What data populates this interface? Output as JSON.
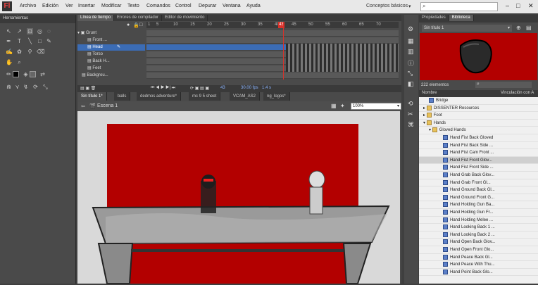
{
  "menubar": {
    "logo": "Fl",
    "items": [
      "Archivo",
      "Edición",
      "Ver",
      "Insertar",
      "Modificar",
      "Texto",
      "Comandos",
      "Control",
      "Depurar",
      "Ventana",
      "Ayuda"
    ],
    "workspace": "Conceptos básicos"
  },
  "tools": {
    "title": "Herramientas"
  },
  "timeline": {
    "tabs": [
      "Línea de tiempo",
      "Errores de compilador",
      "Editor de movimiento"
    ],
    "ruler": [
      "1",
      "5",
      "10",
      "15",
      "20",
      "25",
      "30",
      "35",
      "40",
      "45",
      "50",
      "55",
      "60",
      "65",
      "70"
    ],
    "layers": [
      {
        "name": "Grunt"
      },
      {
        "name": "Front ..."
      },
      {
        "name": "Head"
      },
      {
        "name": "Torso"
      },
      {
        "name": "Back H..."
      },
      {
        "name": "Feet"
      },
      {
        "name": "Backgrou..."
      }
    ],
    "status": {
      "frame": "43",
      "fps": "30.00 fps",
      "time": "1.4 s"
    }
  },
  "document_tabs": [
    "Sin título 1*",
    "balls",
    "dedmos adventure*",
    "mc 9 5 sheet",
    "VCAM_AS2",
    "ng_logos*"
  ],
  "scene": {
    "label": "Escena 1",
    "zoom": "100%"
  },
  "library": {
    "tabs": [
      "Propiedades",
      "Biblioteca"
    ],
    "doc_select": "Sin título 1",
    "count": "222 elementos",
    "col_name": "Nombre",
    "col_link": "Vinculación con A",
    "items": [
      {
        "name": "Bridge",
        "type": "sym",
        "indent": 0
      },
      {
        "name": "DISSENTER Resources",
        "type": "fold",
        "indent": 0
      },
      {
        "name": "Foot",
        "type": "fold",
        "indent": 0
      },
      {
        "name": "Hands",
        "type": "fold",
        "indent": 0
      },
      {
        "name": "Gloved Hands",
        "type": "fold",
        "indent": 1
      },
      {
        "name": "Hand Fist Back Gloved",
        "type": "sym",
        "indent": 2
      },
      {
        "name": "Hand Fist Back Side ...",
        "type": "sym",
        "indent": 2
      },
      {
        "name": "Hand Fist Cam Front ...",
        "type": "sym",
        "indent": 2
      },
      {
        "name": "Hand Fist Front Glov...",
        "type": "sym",
        "indent": 2,
        "selected": true
      },
      {
        "name": "Hand Fist Front Side ...",
        "type": "sym",
        "indent": 2
      },
      {
        "name": "Hand Grab Back Glov...",
        "type": "sym",
        "indent": 2
      },
      {
        "name": "Hand Grab Front Gl...",
        "type": "sym",
        "indent": 2
      },
      {
        "name": "Hand Ground Back Gl...",
        "type": "sym",
        "indent": 2
      },
      {
        "name": "Hand Ground Front G...",
        "type": "sym",
        "indent": 2
      },
      {
        "name": "Hand Holding Gun Ba...",
        "type": "sym",
        "indent": 2
      },
      {
        "name": "Hand Holding Gun Fr...",
        "type": "sym",
        "indent": 2
      },
      {
        "name": "Hand Holding Melee ...",
        "type": "sym",
        "indent": 2
      },
      {
        "name": "Hand Looking Back 1 ...",
        "type": "sym",
        "indent": 2
      },
      {
        "name": "Hand Looking Back 2 ...",
        "type": "sym",
        "indent": 2
      },
      {
        "name": "Hand Open Back Glov...",
        "type": "sym",
        "indent": 2
      },
      {
        "name": "Hand Open Front Glo...",
        "type": "sym",
        "indent": 2
      },
      {
        "name": "Hand Peace Back Gl...",
        "type": "sym",
        "indent": 2
      },
      {
        "name": "Hand Peace With Thu...",
        "type": "sym",
        "indent": 2
      },
      {
        "name": "Hand Point Back Glo...",
        "type": "sym",
        "indent": 2
      }
    ]
  },
  "colors": {
    "stage_bg": "#b30000",
    "accent": "#3b6cb5"
  }
}
